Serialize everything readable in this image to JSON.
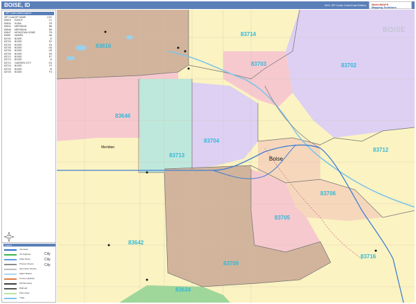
{
  "header": {
    "title": "BOISE, ID",
    "edition": "2021 ZIP Code Color/Cast Edition",
    "brand_line1": "MarketMAPS",
    "brand_line2": "Mapping Solutions"
  },
  "legend": {
    "heading": "ZIP Code Index/Legend",
    "columns": [
      "ZIP Code",
      "ZIP NAME",
      "LOC"
    ],
    "rows": [
      [
        "83616",
        "EAGLE",
        "C1"
      ],
      [
        "83634",
        "KUNA",
        "F8"
      ],
      [
        "83642",
        "MERIDIAN",
        "B6"
      ],
      [
        "83646",
        "MERIDIAN",
        "B3"
      ],
      [
        "83647",
        "MOUNTAIN HOME",
        "F6"
      ],
      [
        "83687",
        "NAMPA",
        "A6"
      ],
      [
        "83702",
        "BOISE",
        "I2"
      ],
      [
        "83703",
        "BOISE",
        "E2"
      ],
      [
        "83704",
        "BOISE",
        "E4"
      ],
      [
        "83705",
        "BOISE",
        "G6"
      ],
      [
        "83706",
        "BOISE",
        "H5"
      ],
      [
        "83709",
        "BOISE",
        "E5"
      ],
      [
        "83712",
        "BOISE",
        "E7"
      ],
      [
        "83713",
        "BOISE",
        "I4"
      ],
      [
        "83714",
        "GARDEN CITY",
        "D3"
      ],
      [
        "83716",
        "BOISE",
        "F2"
      ],
      [
        "83720",
        "BOISE",
        "I5"
      ],
      [
        "83725",
        "BOISE",
        "F4"
      ]
    ]
  },
  "key": {
    "heading": "Legend",
    "items": [
      {
        "label": "Interstate",
        "color": "#2b6fc7"
      },
      {
        "label": "US Highway",
        "color": "#3bb54a"
      },
      {
        "label": "State Route",
        "color": "#5c9be0"
      },
      {
        "label": "Primary Streets",
        "color": "#8a8a8a"
      },
      {
        "label": "Secondary Streets",
        "color": "#bfbfbf"
      },
      {
        "label": "Water Bodies",
        "color": "#a9d6f5"
      },
      {
        "label": "County Highway",
        "color": "#e07a3f"
      },
      {
        "label": "ZIP Boundary",
        "color": "#3e3e3e"
      },
      {
        "label": "Railroad",
        "color": "#555555"
      },
      {
        "label": "Park Areas",
        "color": "#b7e3a3"
      },
      {
        "label": "Trails",
        "color": "#7cc4e8"
      }
    ],
    "city_labels": [
      "City",
      "City",
      "City"
    ]
  },
  "map": {
    "watermark": "BOISE",
    "city_boise": "Boise",
    "city_meridian": "Meridian",
    "zips": {
      "z83714": "83714",
      "z83616": "83616",
      "z83703": "83703",
      "z83702": "83702",
      "z83646": "83646",
      "z83704": "83704",
      "z83713": "83713",
      "z83712": "83712",
      "z83706": "83706",
      "z83705": "83705",
      "z83642": "83642",
      "z83709": "83709",
      "z83716": "83716",
      "z83634": "83634"
    },
    "colors": {
      "yellow": "#fbf3c2",
      "brown": "#d2b49c",
      "purple": "#ddd0f3",
      "pink": "#f6c9cf",
      "teal": "#bfe8dc",
      "peach": "#f6d7bc",
      "river": "#7fc4e8",
      "interstate": "#3f7fd0",
      "green": "#9fd79a"
    }
  }
}
